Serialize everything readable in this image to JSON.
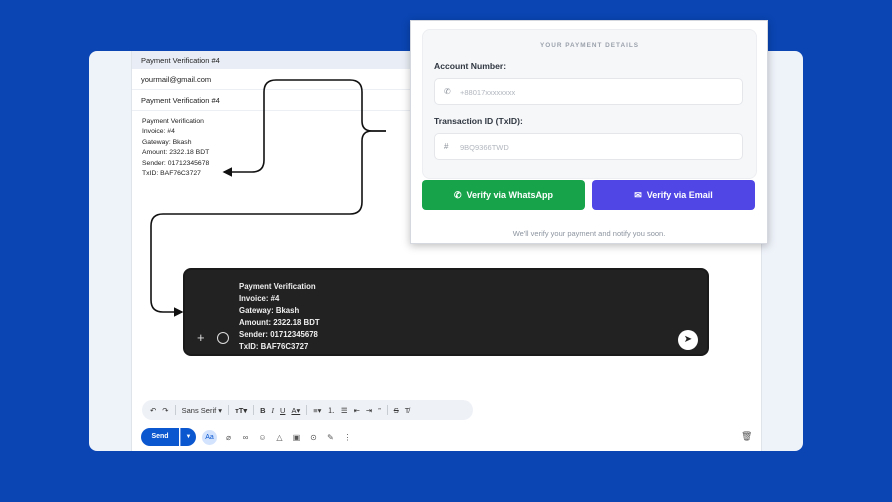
{
  "compose": {
    "window_title": "Payment Verification #4",
    "to": "yourmail@gmail.com",
    "subject": "Payment Verification #4",
    "body_lines": [
      "Payment Verification",
      "Invoice: #4",
      "Gateway: Bkash",
      "Amount: 2322.18 BDT",
      "Sender: 01712345678",
      "TxID: BAF76C3727"
    ],
    "toolbar": {
      "font": "Sans Serif"
    },
    "send_label": "Send",
    "format_label": "Aa"
  },
  "whatsapp": {
    "message_lines": [
      "Payment Verification",
      "Invoice: #4",
      "Gateway: Bkash",
      "Amount: 2322.18 BDT",
      "Sender: 01712345678",
      "TxID: BAF76C3727"
    ]
  },
  "panel": {
    "heading": "YOUR PAYMENT DETAILS",
    "account_label": "Account Number:",
    "account_placeholder": "+88017xxxxxxxx",
    "txid_label": "Transaction ID (TxID):",
    "txid_value": "9BQ9366TWD",
    "whatsapp_button": "Verify via WhatsApp",
    "email_button": "Verify via Email",
    "note": "We'll verify your payment and notify you soon."
  },
  "colors": {
    "background": "#0a45b3",
    "whatsapp_green": "#16a34a",
    "email_indigo": "#4f46e5",
    "gmail_blue": "#0b57d0"
  }
}
